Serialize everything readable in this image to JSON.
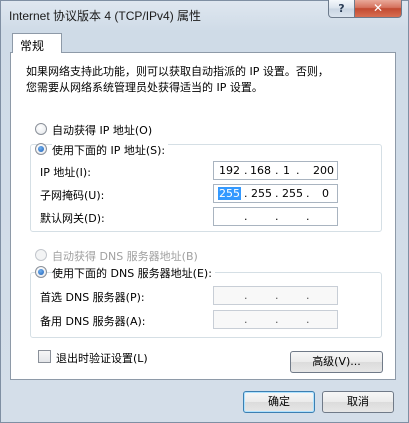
{
  "window": {
    "title": "Internet 协议版本 4 (TCP/IPv4) 属性",
    "help_glyph": "?",
    "close_glyph": "✕"
  },
  "tabs": [
    {
      "label": "常规"
    }
  ],
  "description": {
    "line1": "如果网络支持此功能，则可以获取自动指派的 IP 设置。否则，",
    "line2": "您需要从网络系统管理员处获得适当的 IP 设置。"
  },
  "ip": {
    "auto_label": "自动获得 IP 地址(O)",
    "manual_label": "使用下面的 IP 地址(S):",
    "selected": "manual",
    "address_label": "IP 地址(I):",
    "address": [
      "192",
      "168",
      "1",
      "200"
    ],
    "subnet_label": "子网掩码(U):",
    "subnet": [
      "255",
      "255",
      "255",
      "0"
    ],
    "gateway_label": "默认网关(D):",
    "gateway": [
      "",
      "",
      "",
      ""
    ]
  },
  "dns": {
    "auto_label": "自动获得 DNS 服务器地址(B)",
    "manual_label": "使用下面的 DNS 服务器地址(E):",
    "selected": "manual",
    "preferred_label": "首选 DNS 服务器(P):",
    "preferred": [
      "",
      "",
      "",
      ""
    ],
    "alternate_label": "备用 DNS 服务器(A):",
    "alternate": [
      "",
      "",
      "",
      ""
    ]
  },
  "validate_on_exit": {
    "label": "退出时验证设置(L)",
    "checked": false
  },
  "buttons": {
    "advanced": "高级(V)...",
    "ok": "确定",
    "cancel": "取消"
  },
  "colors": {
    "selection": "#3399ff",
    "window_bg": "#d4dee9",
    "close_red": "#c24a31"
  }
}
